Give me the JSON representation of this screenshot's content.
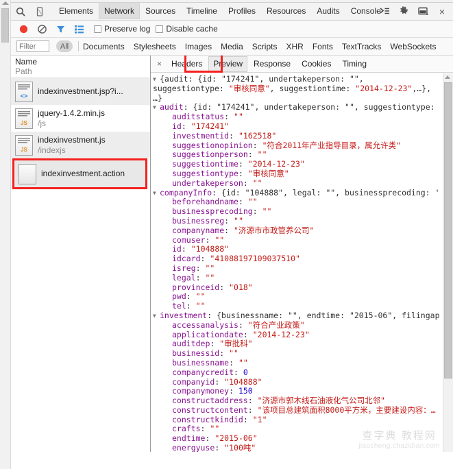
{
  "window": {
    "close_label": "×"
  },
  "main_toolbar": {
    "icons": [
      {
        "name": "search-icon",
        "label": "search"
      },
      {
        "name": "device-mode-icon",
        "label": "device"
      }
    ],
    "tabs": [
      {
        "label": "Elements",
        "selected": false
      },
      {
        "label": "Network",
        "selected": true
      },
      {
        "label": "Sources",
        "selected": false
      },
      {
        "label": "Timeline",
        "selected": false
      },
      {
        "label": "Profiles",
        "selected": false
      },
      {
        "label": "Resources",
        "selected": false
      },
      {
        "label": "Audits",
        "selected": false
      },
      {
        "label": "Console",
        "selected": false
      }
    ],
    "right_icons": [
      {
        "name": "console-drawer-icon",
        "label": "drawer"
      },
      {
        "name": "settings-gear-icon",
        "label": "settings"
      },
      {
        "name": "dock-position-icon",
        "label": "dock"
      }
    ]
  },
  "net_controls": {
    "icons": [
      {
        "name": "record-button-icon",
        "label": "record"
      },
      {
        "name": "clear-button-icon",
        "label": "clear"
      },
      {
        "name": "filter-funnel-icon",
        "label": "filter"
      },
      {
        "name": "view-list-icon",
        "label": "view"
      }
    ],
    "preserve_log_label": "Preserve log",
    "disable_cache_label": "Disable cache"
  },
  "filter_row": {
    "filter_placeholder": "Filter",
    "all_pill": "All",
    "types": [
      "Documents",
      "Stylesheets",
      "Images",
      "Media",
      "Scripts",
      "XHR",
      "Fonts",
      "TextTracks",
      "WebSockets"
    ]
  },
  "file_list": {
    "col_name": "Name",
    "col_path": "Path",
    "rows": [
      {
        "name": "indexinvestment.jsp?i...",
        "path": "",
        "icon": "html-file-icon",
        "badge": "<>",
        "badge_kind": "html",
        "state": "alt",
        "highlighted": false
      },
      {
        "name": "jquery-1.4.2.min.js",
        "path": "/js",
        "icon": "js-file-icon",
        "badge": "JS",
        "badge_kind": "js",
        "state": "white",
        "highlighted": false
      },
      {
        "name": "indexinvestment.js",
        "path": "/indexjs",
        "icon": "js-file-icon",
        "badge": "JS",
        "badge_kind": "js",
        "state": "alt",
        "highlighted": false
      },
      {
        "name": "indexinvestment.action",
        "path": "",
        "icon": "blank-file-icon",
        "badge": "",
        "badge_kind": "none",
        "state": "sel",
        "highlighted": true
      }
    ]
  },
  "detail_tabs": {
    "close_label": "×",
    "tabs": [
      {
        "label": "Headers",
        "selected": false
      },
      {
        "label": "Preview",
        "selected": true
      },
      {
        "label": "Response",
        "selected": false
      },
      {
        "label": "Cookies",
        "selected": false
      },
      {
        "label": "Timing",
        "selected": false
      }
    ]
  },
  "preview": {
    "root_line_1": "{audit: {id: \"174241\", undertakeperson: \"\",",
    "root_line_2_a": "suggestiontype: ",
    "root_line_2_b": "\"审核同意\"",
    "root_line_2_c": ", suggestiontime: ",
    "root_line_2_d": "\"2014-12-23\"",
    "root_line_2_e": ",…},",
    "root_line_3": "…}",
    "groups": [
      {
        "key": "audit",
        "summary": ": {id: \"174241\", undertakeperson: \"\", suggestiontype:",
        "fields": [
          {
            "key": "auditstatus",
            "value": "\"\"",
            "type": "string"
          },
          {
            "key": "id",
            "value": "\"174241\"",
            "type": "string"
          },
          {
            "key": "investmentid",
            "value": "\"162518\"",
            "type": "string"
          },
          {
            "key": "suggestionopinion",
            "value": "\"符合2011年产业指导目录，属允许类\"",
            "type": "string"
          },
          {
            "key": "suggestionperson",
            "value": "\"\"",
            "type": "string"
          },
          {
            "key": "suggestiontime",
            "value": "\"2014-12-23\"",
            "type": "string"
          },
          {
            "key": "suggestiontype",
            "value": "\"审核同意\"",
            "type": "string"
          },
          {
            "key": "undertakeperson",
            "value": "\"\"",
            "type": "string"
          }
        ]
      },
      {
        "key": "companyInfo",
        "summary": ": {id: \"104888\", legal: \"\", businessprecoding: '",
        "fields": [
          {
            "key": "beforehandname",
            "value": "\"\"",
            "type": "string"
          },
          {
            "key": "businessprecoding",
            "value": "\"\"",
            "type": "string"
          },
          {
            "key": "businessreg",
            "value": "\"\"",
            "type": "string"
          },
          {
            "key": "companyname",
            "value": "\"济源市市政管养公司\"",
            "type": "string"
          },
          {
            "key": "comuser",
            "value": "\"\"",
            "type": "string"
          },
          {
            "key": "id",
            "value": "\"104888\"",
            "type": "string"
          },
          {
            "key": "idcard",
            "value": "\"41088197109037510\"",
            "type": "string"
          },
          {
            "key": "isreg",
            "value": "\"\"",
            "type": "string"
          },
          {
            "key": "legal",
            "value": "\"\"",
            "type": "string"
          },
          {
            "key": "provinceid",
            "value": "\"018\"",
            "type": "string"
          },
          {
            "key": "pwd",
            "value": "\"\"",
            "type": "string"
          },
          {
            "key": "tel",
            "value": "\"\"",
            "type": "string"
          }
        ]
      },
      {
        "key": "investment",
        "summary": ": {businessname: \"\", endtime: \"2015-06\", filingap",
        "fields": [
          {
            "key": "accessanalysis",
            "value": "\"符合产业政策\"",
            "type": "string"
          },
          {
            "key": "applicationdate",
            "value": "\"2014-12-23\"",
            "type": "string"
          },
          {
            "key": "auditdep",
            "value": "\"审批科\"",
            "type": "string"
          },
          {
            "key": "businessid",
            "value": "\"\"",
            "type": "string"
          },
          {
            "key": "businessname",
            "value": "\"\"",
            "type": "string"
          },
          {
            "key": "companycredit",
            "value": "0",
            "type": "number"
          },
          {
            "key": "companyid",
            "value": "\"104888\"",
            "type": "string"
          },
          {
            "key": "companymoney",
            "value": "150",
            "type": "number"
          },
          {
            "key": "constructaddress",
            "value": "\"济源市郭木线石油液化气公司北邻\"",
            "type": "string"
          },
          {
            "key": "constructcontent",
            "value": "\"该项目总建筑面积8000平方米，主要建设内容：…",
            "type": "string"
          },
          {
            "key": "constructkindid",
            "value": "\"1\"",
            "type": "string"
          },
          {
            "key": "crafts",
            "value": "\"\"",
            "type": "string"
          },
          {
            "key": "endtime",
            "value": "\"2015-06\"",
            "type": "string"
          },
          {
            "key": "energyuse",
            "value": "\"100吨\"",
            "type": "string"
          }
        ]
      }
    ]
  },
  "watermark": {
    "top": "查字典 教程网",
    "bottom": "jiaocheng.chazidian.com"
  },
  "colors": {
    "annotation_red": "#f5201e",
    "property_purple": "#881391",
    "string_red": "#c41a16",
    "number_blue": "#1c00cf"
  }
}
